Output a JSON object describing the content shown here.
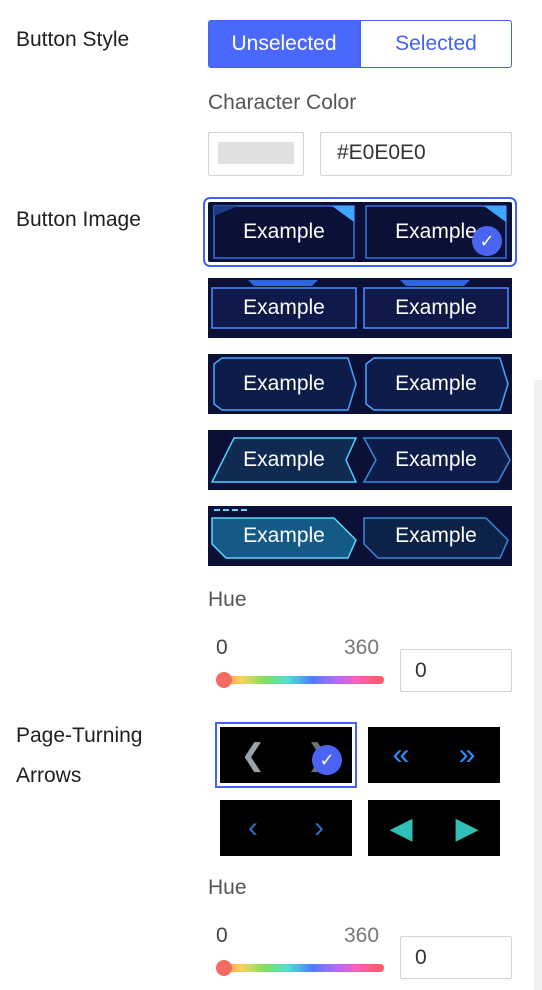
{
  "button_style": {
    "label": "Button Style",
    "options": [
      "Unselected",
      "Selected"
    ],
    "active_index": 0
  },
  "character_color": {
    "label": "Character Color",
    "value": "#E0E0E0",
    "swatch_color": "#E0E0E0"
  },
  "button_image": {
    "label": "Button Image",
    "options": [
      {
        "left": "Example",
        "right": "Example"
      },
      {
        "left": "Example",
        "right": "Example"
      },
      {
        "left": "Example",
        "right": "Example"
      },
      {
        "left": "Example",
        "right": "Example"
      },
      {
        "left": "Example",
        "right": "Example"
      }
    ],
    "selected_index": 0,
    "hue": {
      "label": "Hue",
      "min": "0",
      "max": "360",
      "value": "0"
    }
  },
  "page_turning_arrows": {
    "label_line1": "Page-Turning",
    "label_line2": "Arrows",
    "selected_index": 0,
    "hue": {
      "label": "Hue",
      "min": "0",
      "max": "360",
      "value": "0"
    }
  },
  "colors": {
    "accent": "#4a68fb",
    "frame": "#0b1036",
    "glow": "#3fb0ff"
  }
}
